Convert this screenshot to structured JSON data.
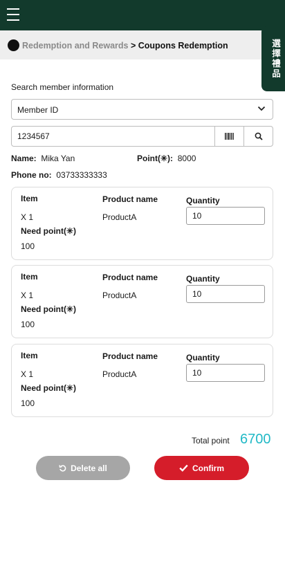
{
  "header": {
    "breadcrumb": {
      "parent": "Redemption and Rewards",
      "separator": " > ",
      "current": "Coupons Redemption"
    },
    "side_tab_label": "選擇禮品"
  },
  "search": {
    "label": "Search member information",
    "type_selected": "Member ID",
    "id_value": "1234567"
  },
  "member": {
    "name_label": "Name:",
    "name": "Mika Yan",
    "point_label": "Point(✳):",
    "point": "8000",
    "phone_label": "Phone no:",
    "phone": "03733333333"
  },
  "items": [
    {
      "item_label": "Item",
      "item_value": "X 1",
      "product_label": "Product name",
      "product_value": "ProductA",
      "quantity_label": "Quantity",
      "quantity_value": "10",
      "need_label": "Need point(✳)",
      "need_value": "100"
    },
    {
      "item_label": "Item",
      "item_value": "X 1",
      "product_label": "Product name",
      "product_value": "ProductA",
      "quantity_label": "Quantity",
      "quantity_value": "10",
      "need_label": "Need point(✳)",
      "need_value": "100"
    },
    {
      "item_label": "Item",
      "item_value": "X 1",
      "product_label": "Product name",
      "product_value": "ProductA",
      "quantity_label": "Quantity",
      "quantity_value": "10",
      "need_label": "Need point(✳)",
      "need_value": "100"
    }
  ],
  "summary": {
    "total_label": "Total point",
    "total_value": "6700"
  },
  "actions": {
    "delete_label": "Delete all",
    "confirm_label": "Confirm"
  },
  "colors": {
    "header_bg": "#123a2c",
    "accent_total": "#21b9c6",
    "confirm": "#d51d2a",
    "delete": "#a6a6a6"
  }
}
